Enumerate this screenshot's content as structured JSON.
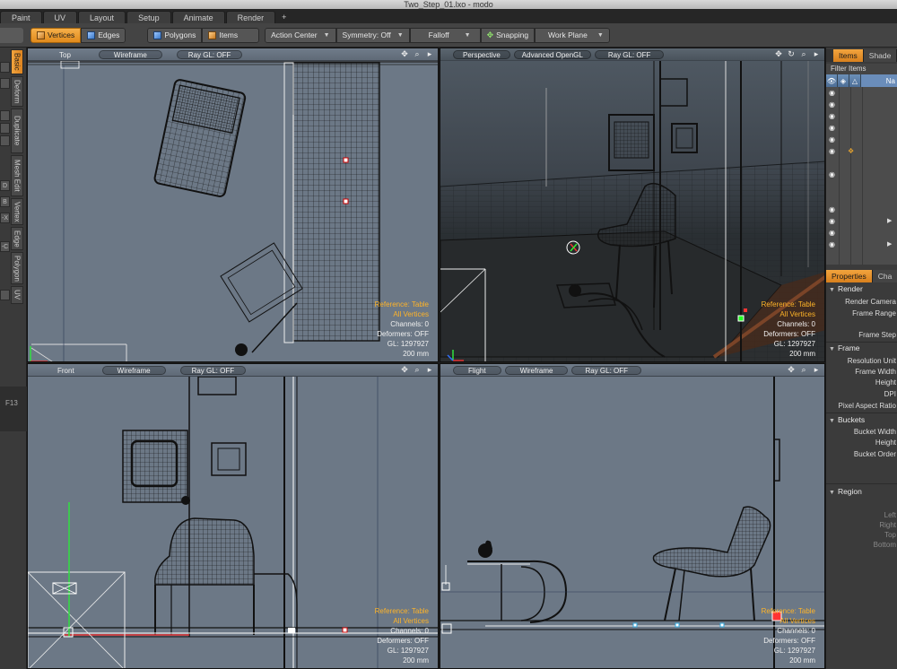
{
  "window": {
    "title": "Two_Step_01.lxo - modo"
  },
  "layout_tabs": [
    "Paint",
    "UV",
    "Layout",
    "Setup",
    "Animate",
    "Render",
    "+"
  ],
  "toolbar": {
    "vertices": "Vertices",
    "edges": "Edges",
    "polygons": "Polygons",
    "items": "Items",
    "action_center": "Action Center",
    "symmetry": "Symmetry: Off",
    "falloff": "Falloff",
    "snapping": "Snapping",
    "work_plane": "Work Plane"
  },
  "left_tabs": {
    "basic": "Basic",
    "deform": "Deform",
    "duplicate": "Duplicate",
    "mesh_edit": "Mesh Edit",
    "vertex": "Vertex",
    "edge": "Edge",
    "polygon": "Polygon",
    "uv": "UV",
    "mini": [
      "D",
      "B",
      "-X",
      "-C"
    ],
    "shortcut": "F13"
  },
  "viewports": {
    "top": {
      "view": "Top",
      "shading": "Wireframe",
      "raygl": "Ray GL: OFF"
    },
    "perspective": {
      "view": "Perspective",
      "shading": "Advanced OpenGL",
      "raygl": "Ray GL: OFF"
    },
    "front": {
      "view": "Front",
      "shading": "Wireframe",
      "raygl": "Ray GL: OFF"
    },
    "flight": {
      "view": "Flight",
      "shading": "Wireframe",
      "raygl": "Ray GL: OFF"
    }
  },
  "viewport_info": {
    "reference": "Reference: Table",
    "all_vertices": "All Vertices",
    "channels": "Channels: 0",
    "deformers": "Deformers: OFF",
    "gl": "GL: 1297927",
    "scale": "200 mm"
  },
  "items_panel": {
    "tab_items": "Items",
    "tab_shade": "Shade",
    "filter": "Filter Items",
    "name_col": "Na"
  },
  "properties_panel": {
    "tab_properties": "Properties",
    "tab_channels": "Cha",
    "render": {
      "title": "Render",
      "render_camera": "Render Camera",
      "frame_range": "Frame Range",
      "frame_step": "Frame Step"
    },
    "frame": {
      "title": "Frame",
      "resolution_unit": "Resolution Unit",
      "frame_width": "Frame Width",
      "height": "Height",
      "dpi": "DPI",
      "pixel_aspect": "Pixel Aspect Ratio"
    },
    "buckets": {
      "title": "Buckets",
      "bucket_width": "Bucket Width",
      "height": "Height",
      "bucket_order": "Bucket Order"
    },
    "region": {
      "title": "Region",
      "left": "Left",
      "right": "Right",
      "top": "Top",
      "bottom": "Bottom"
    }
  },
  "colors": {
    "accent": "#f0a030",
    "viewport_bg": "#6c7886",
    "info_orange": "#ffb428"
  }
}
